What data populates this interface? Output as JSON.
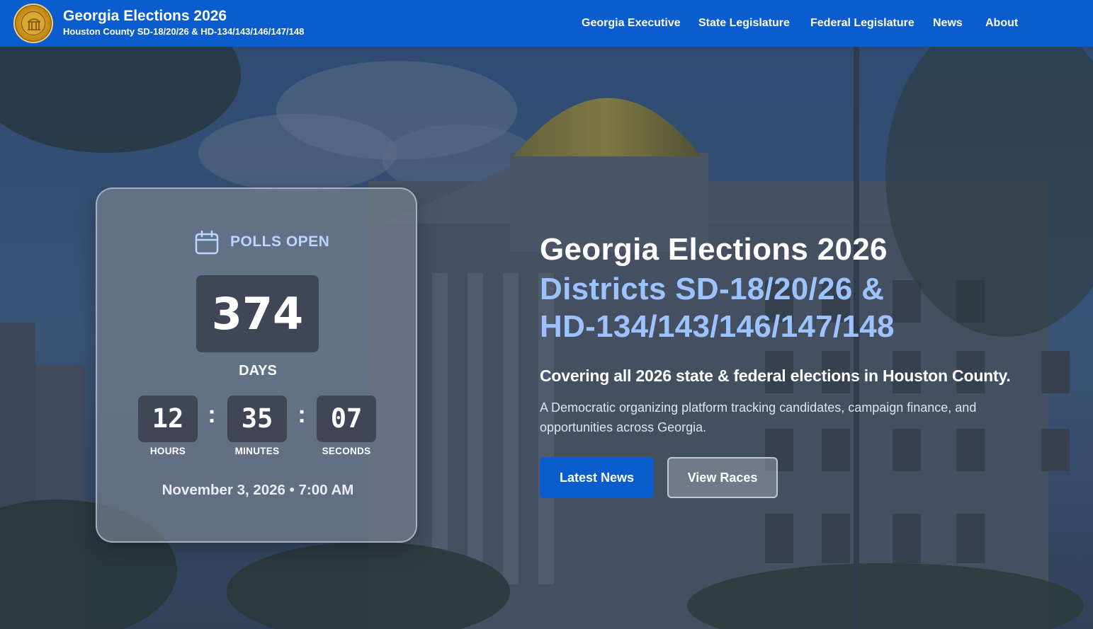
{
  "header": {
    "brand_title": "Georgia Elections 2026",
    "brand_subtitle": "Houston County SD-18/20/26 & HD-134/143/146/147/148",
    "logo_icon": "georgia-state-seal",
    "nav": [
      "Georgia Executive",
      "State Legislature",
      "Federal Legislature",
      "News",
      "About"
    ]
  },
  "countdown": {
    "icon": "calendar-icon",
    "label": "POLLS OPEN",
    "days": "374",
    "days_label": "DAYS",
    "hours": "12",
    "minutes": "35",
    "seconds": "07",
    "hours_label": "HOURS",
    "minutes_label": "MINUTES",
    "seconds_label": "SECONDS",
    "separator": ":",
    "date": "November 3, 2026 • 7:00 AM"
  },
  "hero": {
    "title": "Georgia Elections 2026",
    "subtitle": "Districts SD-18/20/26 & HD-134/143/146/147/148",
    "tagline": "Covering all 2026 state & federal elections in Houston County.",
    "description": "A Democratic organizing platform tracking candidates, campaign finance, and opportunities across Georgia.",
    "primary_button": "Latest News",
    "secondary_button": "View Races"
  },
  "colors": {
    "brand_blue": "#0b5ccc",
    "accent_light_blue": "#9cc3ff",
    "overlay": "#2c3e55"
  }
}
